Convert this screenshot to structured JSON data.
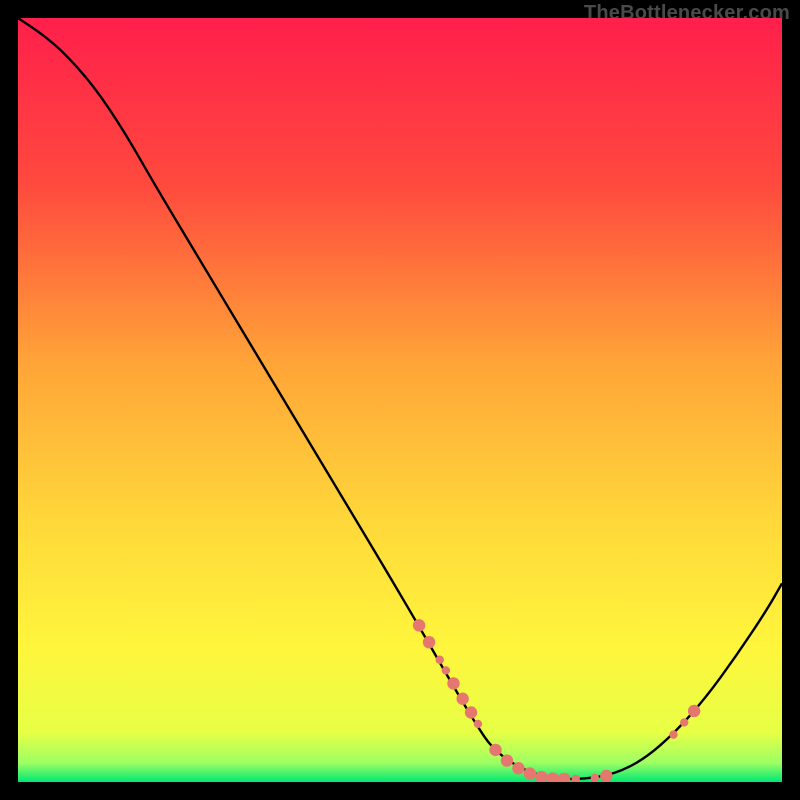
{
  "watermark": "TheBottlenecker.com",
  "chart_data": {
    "type": "line",
    "title": "",
    "xlabel": "",
    "ylabel": "",
    "xlim": [
      0,
      100
    ],
    "ylim": [
      0,
      100
    ],
    "gradient_stops": [
      {
        "offset": 0,
        "color": "#ff1f4b"
      },
      {
        "offset": 0.22,
        "color": "#ff4a3e"
      },
      {
        "offset": 0.45,
        "color": "#ffa438"
      },
      {
        "offset": 0.66,
        "color": "#ffd83a"
      },
      {
        "offset": 0.82,
        "color": "#fff53c"
      },
      {
        "offset": 0.935,
        "color": "#e7ff45"
      },
      {
        "offset": 0.975,
        "color": "#9dff63"
      },
      {
        "offset": 1.0,
        "color": "#00e874"
      }
    ],
    "series": [
      {
        "name": "bottleneck-curve",
        "color": "#000000",
        "x": [
          0,
          3,
          6,
          10,
          14,
          18,
          24,
          30,
          36,
          42,
          48,
          53,
          57,
          60,
          62,
          65,
          68,
          71,
          74,
          78,
          82,
          86,
          90,
          94,
          98,
          100
        ],
        "y": [
          100,
          98,
          95.5,
          91,
          85,
          78,
          68,
          58,
          48,
          38,
          28,
          19.5,
          12.5,
          7.5,
          4.5,
          2.2,
          0.9,
          0.4,
          0.4,
          1.0,
          3.0,
          6.5,
          11.0,
          16.5,
          22.5,
          26
        ]
      }
    ],
    "markers": {
      "color": "#e6776e",
      "radius_small": 4.2,
      "radius_large": 6.2,
      "clusters": [
        {
          "along": "left",
          "points": [
            {
              "x": 52.5,
              "y": 20.5,
              "r": "l"
            },
            {
              "x": 53.8,
              "y": 18.3,
              "r": "l"
            },
            {
              "x": 55.2,
              "y": 16.0,
              "r": "s"
            },
            {
              "x": 56.0,
              "y": 14.6,
              "r": "s"
            },
            {
              "x": 57.0,
              "y": 12.9,
              "r": "l"
            },
            {
              "x": 58.2,
              "y": 10.9,
              "r": "l"
            },
            {
              "x": 59.3,
              "y": 9.1,
              "r": "l"
            },
            {
              "x": 60.2,
              "y": 7.6,
              "r": "s"
            }
          ]
        },
        {
          "along": "valley",
          "points": [
            {
              "x": 62.5,
              "y": 4.2,
              "r": "l"
            },
            {
              "x": 64.0,
              "y": 2.8,
              "r": "l"
            },
            {
              "x": 65.5,
              "y": 1.8,
              "r": "l"
            },
            {
              "x": 67.0,
              "y": 1.1,
              "r": "l"
            },
            {
              "x": 68.5,
              "y": 0.65,
              "r": "l"
            },
            {
              "x": 70.0,
              "y": 0.45,
              "r": "l"
            },
            {
              "x": 71.5,
              "y": 0.4,
              "r": "l"
            },
            {
              "x": 73.0,
              "y": 0.4,
              "r": "s"
            },
            {
              "x": 75.5,
              "y": 0.55,
              "r": "s"
            },
            {
              "x": 77.0,
              "y": 0.8,
              "r": "l"
            }
          ]
        },
        {
          "along": "right",
          "points": [
            {
              "x": 85.8,
              "y": 6.2,
              "r": "s"
            },
            {
              "x": 87.2,
              "y": 7.8,
              "r": "s"
            },
            {
              "x": 88.5,
              "y": 9.3,
              "r": "l"
            }
          ]
        }
      ]
    }
  }
}
